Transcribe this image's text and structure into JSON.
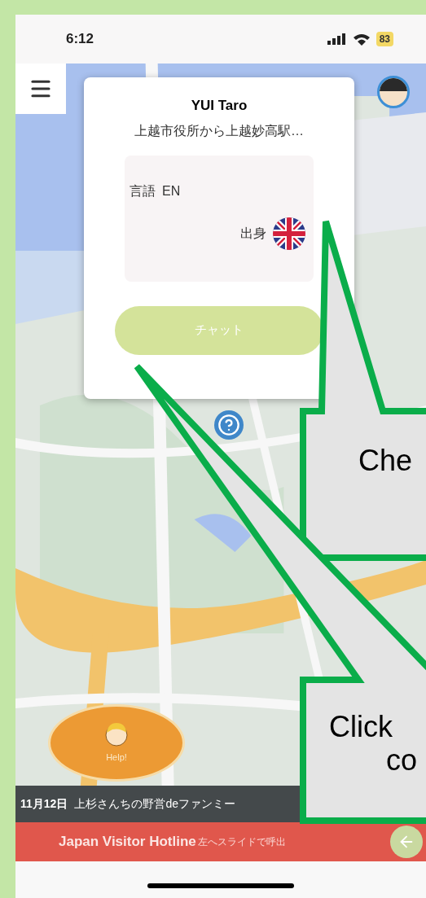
{
  "status_bar": {
    "time": "6:12",
    "battery": "83"
  },
  "profile_card": {
    "name": "YUI Taro",
    "route": "上越市役所から上越妙高駅…",
    "language_label": "言語",
    "language": "EN",
    "origin_label": "出身",
    "chat_button": {
      "label": "チャット",
      "disabled": true
    }
  },
  "help_button": {
    "label": "Help!"
  },
  "news_ticker": {
    "date": "11月12日",
    "headline": "上杉さんちの野営deファンミー"
  },
  "hotline": {
    "title": "Japan Visitor Hotline",
    "hint": "左へスライドで呼出"
  },
  "callouts": [
    {
      "lines": [
        "Che"
      ]
    },
    {
      "lines": [
        "Click",
        "co"
      ]
    }
  ]
}
